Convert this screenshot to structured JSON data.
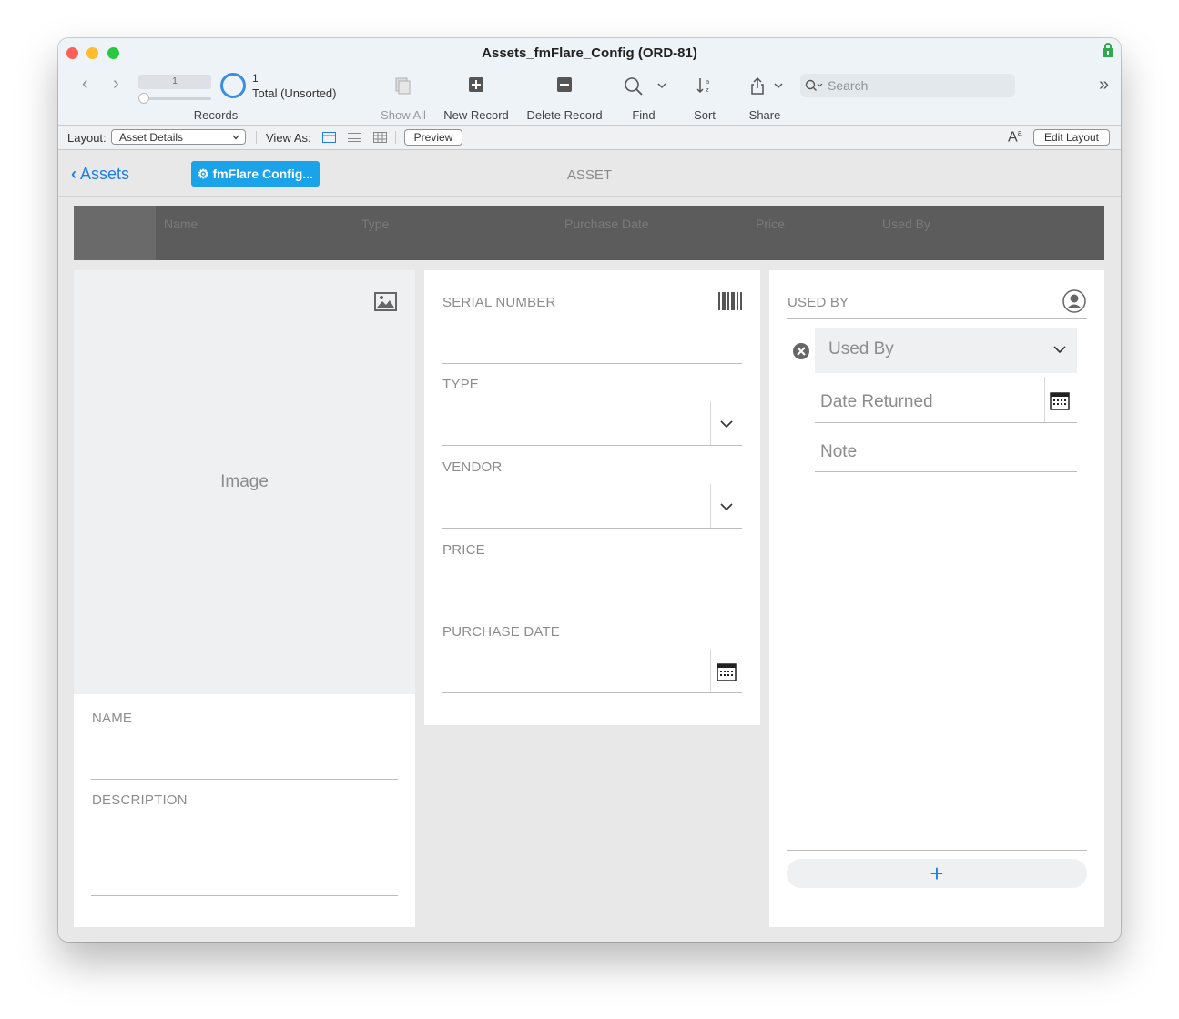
{
  "window": {
    "title": "Assets_fmFlare_Config (ORD-81)"
  },
  "toolbar": {
    "record_number": "1",
    "record_count": "1",
    "record_status": "Total (Unsorted)",
    "records_label": "Records",
    "show_all_label": "Show All",
    "new_record_label": "New Record",
    "delete_record_label": "Delete Record",
    "find_label": "Find",
    "sort_label": "Sort",
    "share_label": "Share",
    "search_placeholder": "Search"
  },
  "layout_bar": {
    "layout_label": "Layout:",
    "layout_value": "Asset Details",
    "view_as_label": "View As:",
    "preview_label": "Preview",
    "edit_layout_label": "Edit Layout"
  },
  "header": {
    "back_label": "Assets",
    "config_button_label": "fmFlare Config...",
    "section_title": "ASSET"
  },
  "list_columns": [
    "Name",
    "Type",
    "Purchase Date",
    "Price",
    "Used By"
  ],
  "left_panel": {
    "image_label": "Image",
    "name_label": "NAME",
    "description_label": "DESCRIPTION"
  },
  "middle_panel": {
    "serial_label": "SERIAL NUMBER",
    "type_label": "TYPE",
    "vendor_label": "VENDOR",
    "price_label": "PRICE",
    "purchase_date_label": "PURCHASE DATE"
  },
  "right_panel": {
    "used_by_label": "USED BY",
    "used_by_placeholder": "Used By",
    "date_returned_placeholder": "Date Returned",
    "note_placeholder": "Note",
    "add_label": "+"
  },
  "colors": {
    "accent": "#1f7ee3",
    "config_button": "#1aa3e8",
    "list_header": "#5c5c5c"
  }
}
